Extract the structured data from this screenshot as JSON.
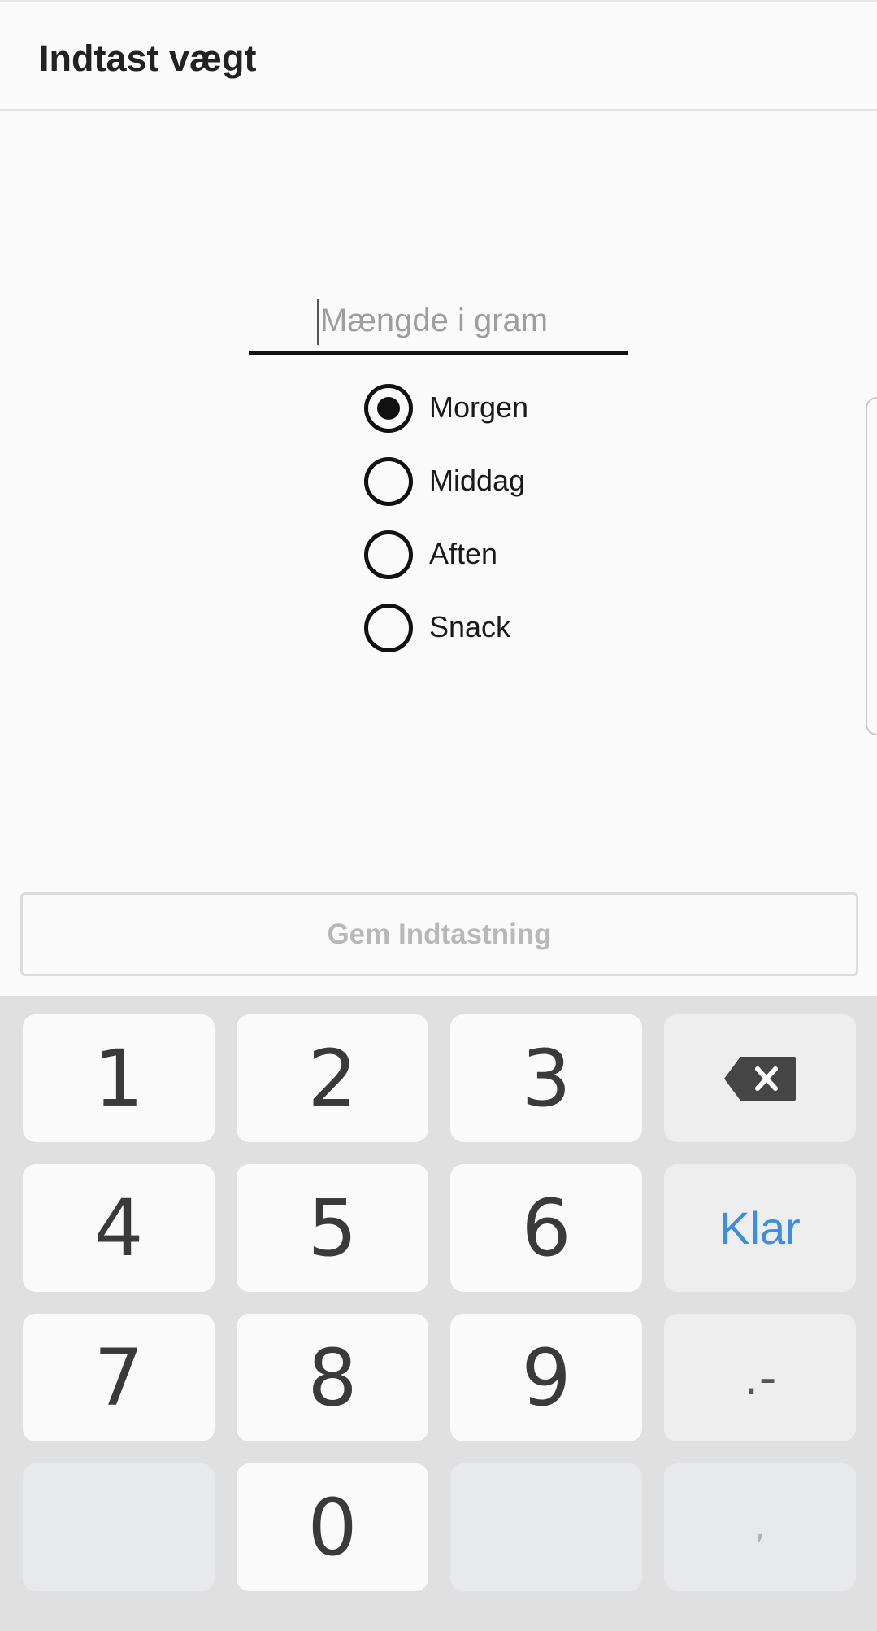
{
  "toolbar": {
    "title": "Indtast vægt"
  },
  "amount_input": {
    "placeholder": "Mængde i gram",
    "value": ""
  },
  "meal_options": [
    {
      "label": "Morgen",
      "selected": true
    },
    {
      "label": "Middag",
      "selected": false
    },
    {
      "label": "Aften",
      "selected": false
    },
    {
      "label": "Snack",
      "selected": false
    }
  ],
  "save_button": {
    "label": "Gem Indtastning"
  },
  "keyboard": {
    "keys": {
      "k1": "1",
      "k2": "2",
      "k3": "3",
      "k4": "4",
      "k5": "5",
      "k6": "6",
      "k7": "7",
      "k8": "8",
      "k9": "9",
      "k0": "0",
      "done": "Klar",
      "dot_minus": ".-",
      "comma": ","
    },
    "backspace_icon": "backspace-icon",
    "accent_color": "#3b8ee0"
  }
}
